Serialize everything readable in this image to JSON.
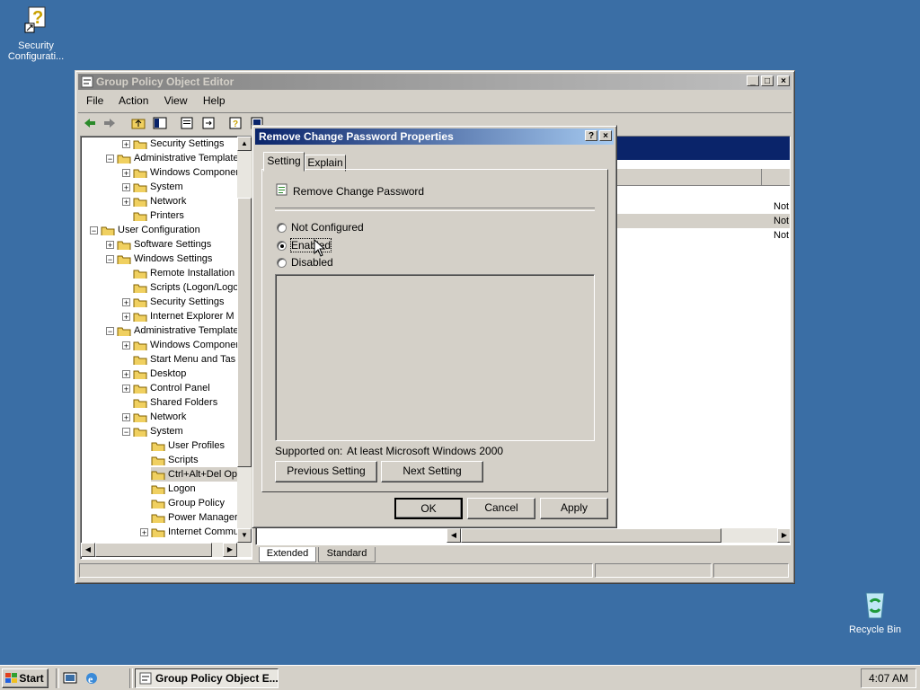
{
  "desktop": {
    "icons": [
      {
        "label": "Security Configurati...",
        "icon": "security-config-icon"
      },
      {
        "label": "Recycle Bin",
        "icon": "recycle-bin-icon"
      }
    ]
  },
  "gpo_window": {
    "title": "Group Policy Object Editor",
    "menu": [
      "File",
      "Action",
      "View",
      "Help"
    ],
    "tree": [
      {
        "label": "Security Settings",
        "level": 2
      },
      {
        "label": "Administrative Templates",
        "level": 1
      },
      {
        "label": "Windows Components",
        "level": 2
      },
      {
        "label": "System",
        "level": 2
      },
      {
        "label": "Network",
        "level": 2
      },
      {
        "label": "Printers",
        "level": 2
      },
      {
        "label": "User Configuration",
        "level": 0
      },
      {
        "label": "Software Settings",
        "level": 1
      },
      {
        "label": "Windows Settings",
        "level": 1
      },
      {
        "label": "Remote Installation",
        "level": 2
      },
      {
        "label": "Scripts (Logon/Logoff)",
        "level": 2
      },
      {
        "label": "Security Settings",
        "level": 2
      },
      {
        "label": "Internet Explorer M",
        "level": 2
      },
      {
        "label": "Administrative Templates",
        "level": 1
      },
      {
        "label": "Windows Components",
        "level": 2
      },
      {
        "label": "Start Menu and Tas",
        "level": 2
      },
      {
        "label": "Desktop",
        "level": 2
      },
      {
        "label": "Control Panel",
        "level": 2
      },
      {
        "label": "Shared Folders",
        "level": 2
      },
      {
        "label": "Network",
        "level": 2
      },
      {
        "label": "System",
        "level": 2
      },
      {
        "label": "User Profiles",
        "level": 3
      },
      {
        "label": "Scripts",
        "level": 3
      },
      {
        "label": "Ctrl+Alt+Del Op",
        "level": 3
      },
      {
        "label": "Logon",
        "level": 3
      },
      {
        "label": "Group Policy",
        "level": 3
      },
      {
        "label": "Power Manager",
        "level": 3
      },
      {
        "label": "Internet Commu",
        "level": 3
      }
    ],
    "right_values": [
      "Not",
      "Not",
      "Not"
    ],
    "tabs": [
      "Extended",
      "Standard"
    ]
  },
  "dialog": {
    "title": "Remove Change Password Properties",
    "tabs": [
      "Setting",
      "Explain"
    ],
    "policy_name": "Remove Change Password",
    "options": [
      {
        "label": "Not Configured",
        "selected": false
      },
      {
        "label": "Enabled",
        "selected": true
      },
      {
        "label": "Disabled",
        "selected": false
      }
    ],
    "supported_label": "Supported on:",
    "supported_value": "At least Microsoft Windows 2000",
    "prev_button": "Previous Setting",
    "next_button": "Next Setting",
    "ok_button": "OK",
    "cancel_button": "Cancel",
    "apply_button": "Apply"
  },
  "taskbar": {
    "start_label": "Start",
    "task_label": "Group Policy Object E...",
    "clock": "4:07 AM"
  }
}
